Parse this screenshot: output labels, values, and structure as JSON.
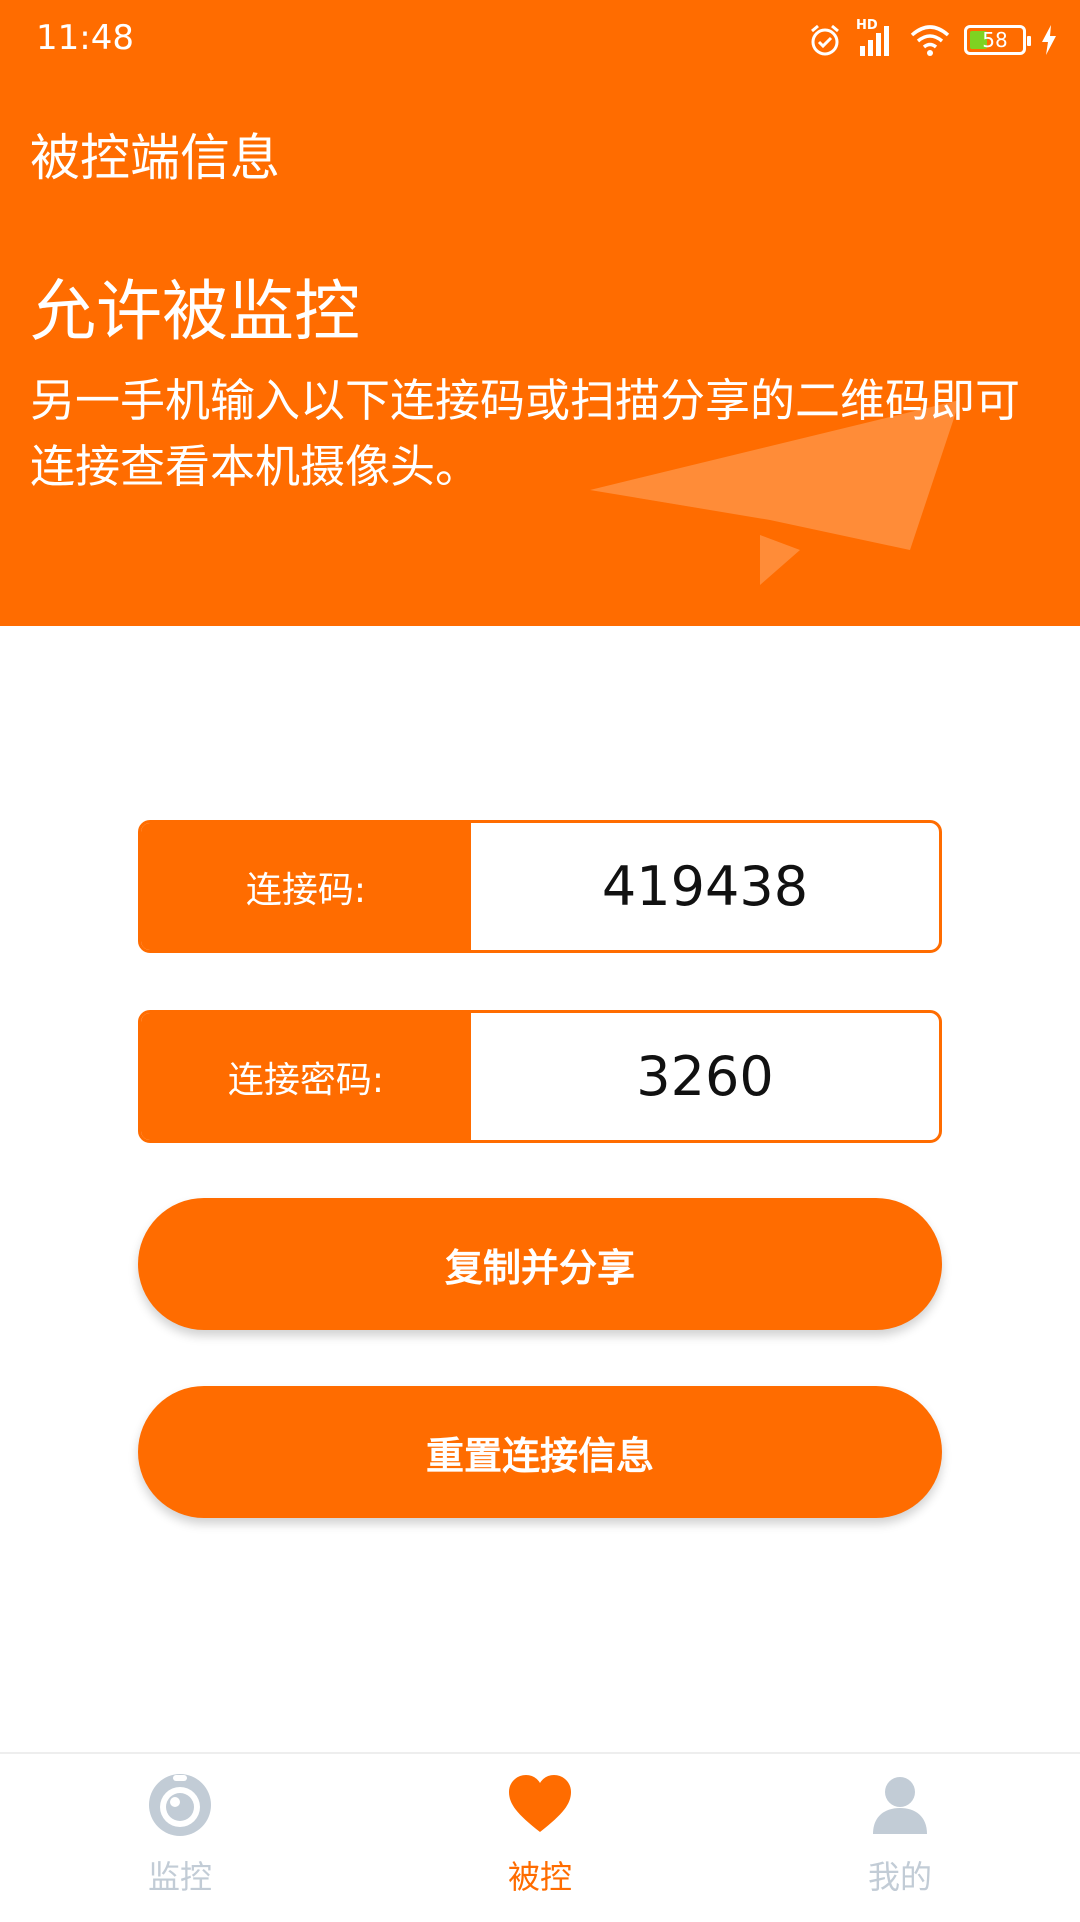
{
  "status_bar": {
    "time": "11:48",
    "battery_level": "58",
    "network_label": "HD"
  },
  "header": {
    "title": "被控端信息",
    "heading": "允许被监控",
    "description": "另一手机输入以下连接码或扫描分享的二维码即可连接查看本机摄像头。"
  },
  "connection": {
    "code_label": "连接码:",
    "code_value": "419438",
    "password_label": "连接密码:",
    "password_value": "3260"
  },
  "actions": {
    "copy_share_label": "复制并分享",
    "reset_label": "重置连接信息"
  },
  "bottom_nav": {
    "items": [
      {
        "label": "监控",
        "icon": "camera-icon",
        "active": false
      },
      {
        "label": "被控",
        "icon": "heart-icon",
        "active": true
      },
      {
        "label": "我的",
        "icon": "user-icon",
        "active": false
      }
    ]
  },
  "colors": {
    "accent": "#ff6c00",
    "inactive": "#c2ccd6"
  }
}
